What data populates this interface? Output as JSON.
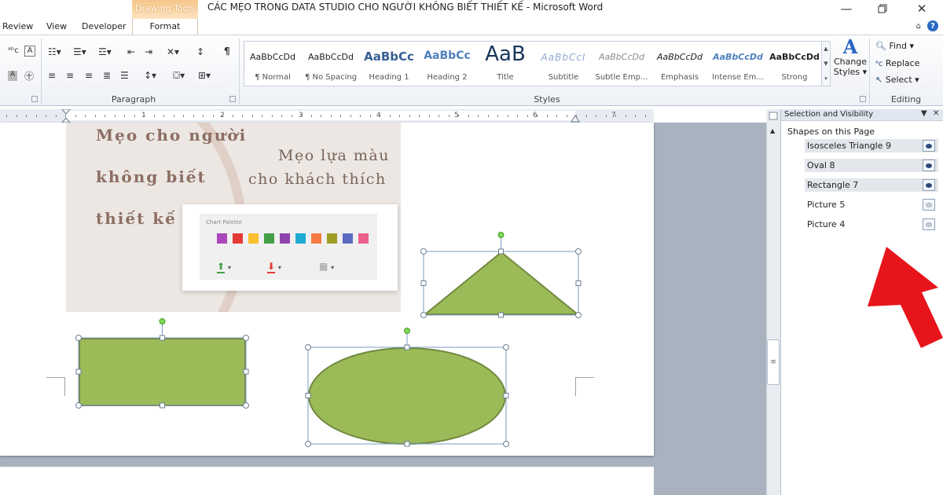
{
  "window": {
    "contextual_tab_group": "Drawing Tools",
    "title": "CÁC MẸO TRONG DATA STUDIO CHO NGƯỜI KHÔNG BIẾT THIẾT KẾ  -  Microsoft Word"
  },
  "ribbon": {
    "tabs": [
      "Review",
      "View",
      "Developer"
    ],
    "contextual_tab": "Format",
    "groups": {
      "paragraph": "Paragraph",
      "styles": "Styles",
      "editing": "Editing"
    },
    "styles_gallery": [
      {
        "sample": "AaBbCcDd",
        "name": "¶ Normal"
      },
      {
        "sample": "AaBbCcDd",
        "name": "¶ No Spacing"
      },
      {
        "sample": "AaBbCc",
        "name": "Heading 1"
      },
      {
        "sample": "AaBbCc",
        "name": "Heading 2"
      },
      {
        "sample": "AaB",
        "name": "Title"
      },
      {
        "sample": "AaBbCcI",
        "name": "Subtitle"
      },
      {
        "sample": "AaBbCcDd",
        "name": "Subtle Emp..."
      },
      {
        "sample": "AaBbCcDd",
        "name": "Emphasis"
      },
      {
        "sample": "AaBbCcDd",
        "name": "Intense Em..."
      },
      {
        "sample": "AaBbCcDd",
        "name": "Strong"
      }
    ],
    "change_styles": {
      "line1": "Change",
      "line2": "Styles ▾",
      "icon": "A"
    },
    "editing": {
      "find": "Find ▾",
      "replace": "Replace",
      "select": "Select ▾"
    }
  },
  "ruler": {
    "numbers": [
      "1",
      "2",
      "3",
      "4",
      "5",
      "6",
      "7"
    ]
  },
  "document": {
    "picture_lines_left": [
      "Mẹo cho người",
      "không biết",
      "thiết kế"
    ],
    "picture_lines_right": [
      "Mẹo lựa màu",
      "cho khách thích"
    ],
    "palette": {
      "title": "Chart Palette",
      "swatches": [
        "#ab47bc",
        "#e53935",
        "#fbc02d",
        "#43a047",
        "#8e44ad",
        "#1eaad1",
        "#f57c43",
        "#9e9d24",
        "#5c6bc0",
        "#ec5f8a"
      ],
      "tool_colors": [
        "#43a047",
        "#e53935",
        "#9e9e9e"
      ]
    },
    "shape_fill": "#9bbb59",
    "shape_stroke": "#71893f"
  },
  "selection_pane": {
    "title": "Selection and Visibility",
    "subtitle": "Shapes on this Page",
    "items": [
      {
        "name": "Isosceles Triangle 9",
        "visible": true
      },
      {
        "name": "Oval 8",
        "visible": true
      },
      {
        "name": "Rectangle 7",
        "visible": true
      },
      {
        "name": "Picture 5",
        "visible": false
      },
      {
        "name": "Picture 4",
        "visible": false
      }
    ]
  },
  "annotation": {
    "arrow_color": "#e8141b"
  }
}
